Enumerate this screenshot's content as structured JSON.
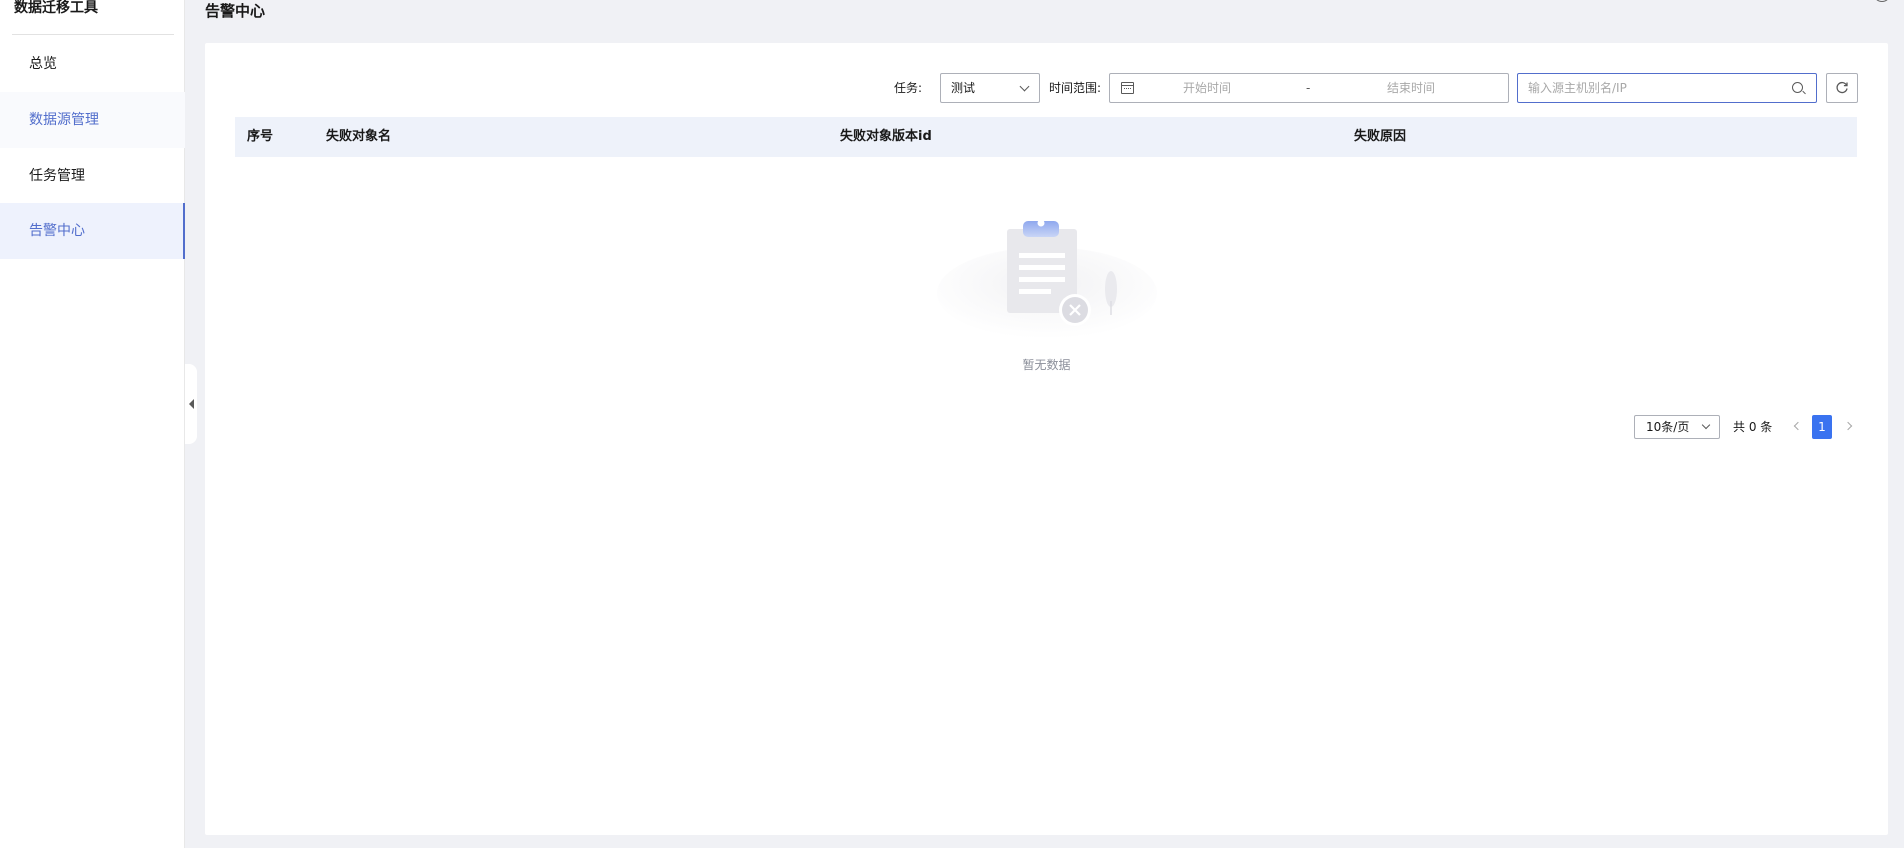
{
  "sidebar": {
    "title": "数据迁移工具",
    "items": [
      {
        "label": "总览"
      },
      {
        "label": "数据源管理"
      },
      {
        "label": "任务管理"
      },
      {
        "label": "告警中心"
      }
    ]
  },
  "header": {
    "title": "告警中心"
  },
  "toolbar": {
    "task_label": "任务:",
    "task_value": "测试",
    "range_label": "时间范围:",
    "range_start": "开始时间",
    "range_sep": "-",
    "range_end": "结束时间",
    "search_placeholder": "输入源主机别名/IP",
    "search_value": ""
  },
  "table": {
    "columns": [
      "序号",
      "失败对象名",
      "失败对象版本id",
      "失败原因"
    ],
    "rows": [],
    "empty_text": "暂无数据"
  },
  "pagination": {
    "page_size": "10条/页",
    "total": "共 0 条",
    "current_page": "1"
  },
  "colors": {
    "accent": "#526ecc",
    "page_active": "#3a73f0",
    "table_header_bg": "#eef2fa",
    "page_bg": "#f0f1f5"
  }
}
